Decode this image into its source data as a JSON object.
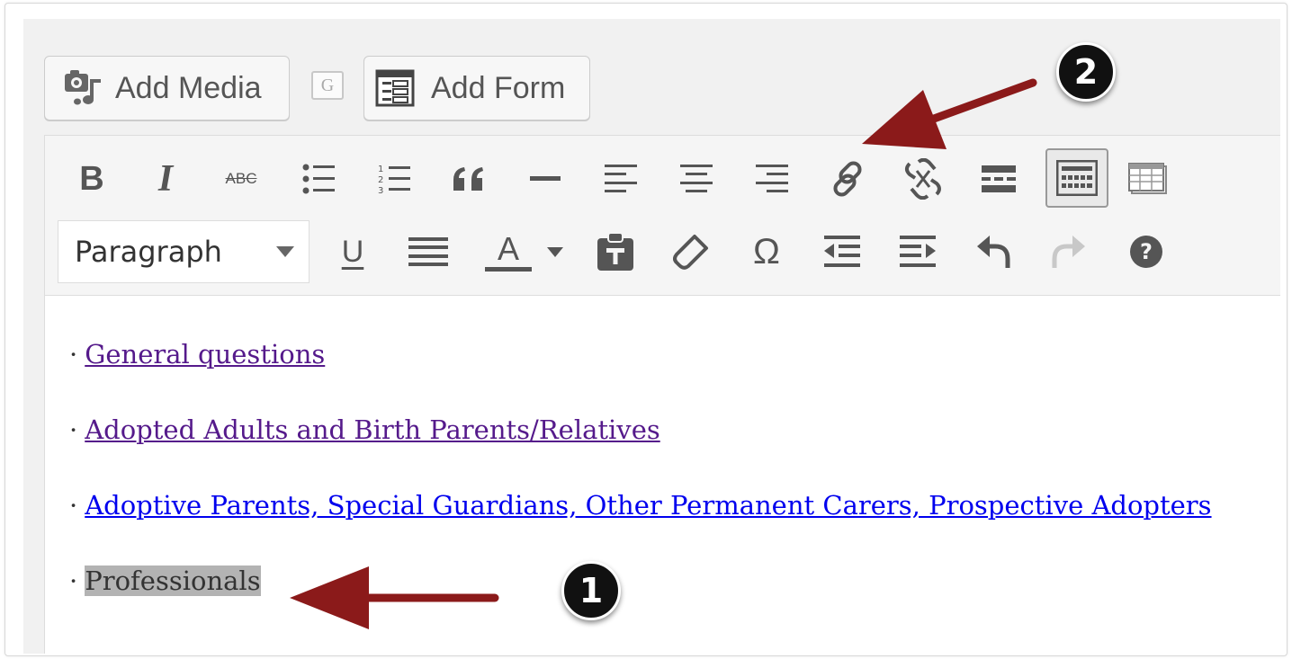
{
  "media_buttons": {
    "add_media_label": "Add Media",
    "gallery_icon_letter": "G",
    "add_form_label": "Add Form"
  },
  "toolbar": {
    "row1_icons": [
      "bold-icon",
      "italic-icon",
      "strikethrough-icon",
      "bulleted-list-icon",
      "numbered-list-icon",
      "blockquote-icon",
      "horizontal-line-icon",
      "align-left-icon",
      "align-center-icon",
      "align-right-icon",
      "insert-link-icon",
      "remove-link-icon",
      "read-more-icon",
      "toolbar-toggle-icon",
      "table-icon"
    ],
    "row2_icons": [
      "underline-icon",
      "justify-icon",
      "text-color-icon",
      "text-color-dropdown-icon",
      "paste-as-text-icon",
      "clear-formatting-icon",
      "special-character-icon",
      "decrease-indent-icon",
      "increase-indent-icon",
      "undo-icon",
      "redo-icon",
      "help-icon"
    ],
    "bold_glyph": "B",
    "italic_glyph": "I",
    "strikethrough_glyph": "ABC",
    "underline_glyph": "U",
    "text_color_glyph": "A",
    "omega_glyph": "Ω",
    "help_glyph": "?",
    "format_select": {
      "value": "Paragraph"
    }
  },
  "content": {
    "bullet": "·",
    "lines": [
      {
        "text": "General questions",
        "kind": "link-visited"
      },
      {
        "text": "Adopted Adults and Birth Parents/Relatives",
        "kind": "link-visited"
      },
      {
        "text": "Adoptive Parents, Special Guardians, Other Permanent Carers, Prospective Adopters",
        "kind": "link"
      },
      {
        "text": "Professionals",
        "kind": "selected-text"
      }
    ]
  },
  "annotations": {
    "badge_1": "1",
    "badge_2": "2",
    "arrow_color": "#8b1a1a"
  },
  "colors": {
    "visited_link": "#551a8b",
    "link": "#0000ee",
    "selection": "#b3b3b3",
    "toolbar_bg": "#f5f5f5"
  }
}
